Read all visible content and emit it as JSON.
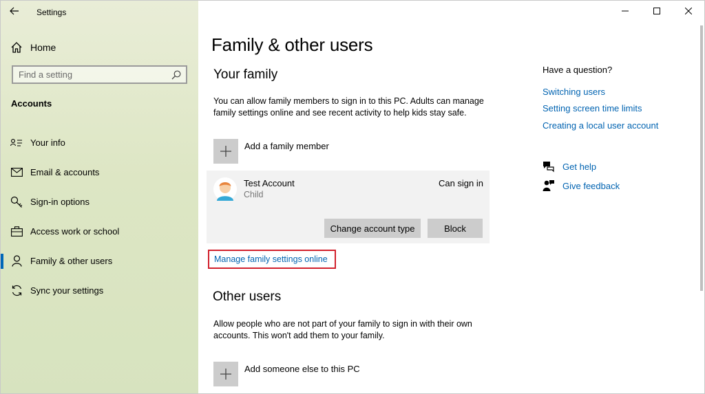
{
  "window": {
    "app_title": "Settings",
    "icons": {
      "back": "back-arrow-icon",
      "minimize": "minimize-icon",
      "maximize": "maximize-icon",
      "close": "close-icon"
    }
  },
  "sidebar": {
    "home_label": "Home",
    "search_placeholder": "Find a setting",
    "section_title": "Accounts",
    "items": [
      {
        "label": "Your info",
        "icon": "contact-card-icon",
        "active": false
      },
      {
        "label": "Email & accounts",
        "icon": "mail-icon",
        "active": false
      },
      {
        "label": "Sign-in options",
        "icon": "key-icon",
        "active": false
      },
      {
        "label": "Access work or school",
        "icon": "briefcase-icon",
        "active": false
      },
      {
        "label": "Family & other users",
        "icon": "person-icon",
        "active": true
      },
      {
        "label": "Sync your settings",
        "icon": "sync-icon",
        "active": false
      }
    ]
  },
  "main": {
    "page_title": "Family & other users",
    "your_family": {
      "heading": "Your family",
      "description": "You can allow family members to sign in to this PC. Adults can manage family settings online and see recent activity to help kids stay safe.",
      "add_label": "Add a family member",
      "account": {
        "name": "Test Account",
        "role": "Child",
        "status": "Can sign in",
        "change_type_label": "Change account type",
        "block_label": "Block"
      },
      "manage_link": "Manage family settings online"
    },
    "other_users": {
      "heading": "Other users",
      "description": "Allow people who are not part of your family to sign in with their own accounts. This won't add them to your family.",
      "add_label": "Add someone else to this PC"
    }
  },
  "help": {
    "question": "Have a question?",
    "links": [
      "Switching users",
      "Setting screen time limits",
      "Creating a local user account"
    ],
    "get_help": "Get help",
    "give_feedback": "Give feedback"
  },
  "colors": {
    "accent": "#0067b8",
    "link": "#0063b1",
    "highlight_border": "#d11f2b"
  }
}
